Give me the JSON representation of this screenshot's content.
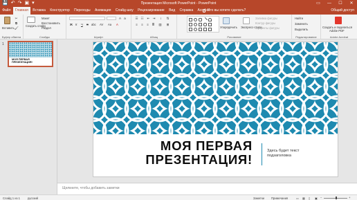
{
  "titlebar": {
    "title": "Презентация Microsoft PowerPoint  -  PowerPoint",
    "qat": [
      "💾",
      "↶",
      "↷",
      "▣",
      "▾"
    ],
    "controls": [
      "▭",
      "—",
      "☐",
      "✕"
    ]
  },
  "tabs": [
    "Файл",
    "Главная",
    "Вставка",
    "Конструктор",
    "Переходы",
    "Анимация",
    "Слайд-шоу",
    "Рецензирование",
    "Вид",
    "Справка",
    "Acrobat"
  ],
  "active_tab_index": 1,
  "tellme": "Что вы хотите сделать?",
  "share": "Общий доступ",
  "ribbon": {
    "clipboard": {
      "paste": "Вставить",
      "label": "Буфер обмена"
    },
    "slides": {
      "create": "Создать слайд",
      "layout": "Макет",
      "reset": "Восстановить",
      "section": "Раздел",
      "label": "Слайды"
    },
    "font": {
      "label": "Шрифт",
      "bold": "Ж",
      "italic": "К",
      "underline": "Ч",
      "strike": "S",
      "shadow": "abc",
      "spacing": "AV",
      "case": "Aa",
      "color": "A"
    },
    "paragraph": {
      "label": "Абзац"
    },
    "drawing": {
      "arrange": "Упорядочить",
      "quickstyles": "Экспресс-стили",
      "fill": "Заливка фигуры",
      "outline": "Контур фигуры",
      "effects": "Эффекты фигуры",
      "label": "Рисование"
    },
    "editing": {
      "find": "Найти",
      "replace": "Заменить",
      "select": "Выделить",
      "label": "Редактирование"
    },
    "acrobat": {
      "create": "Создать и поделиться",
      "pdf": "Adobe PDF",
      "label": "Adobe Acrobat"
    }
  },
  "thumbnail": {
    "number": "1",
    "title_line1": "МОЯ ПЕРВАЯ",
    "title_line2": "ПРЕЗЕНТАЦИЯ!"
  },
  "slide": {
    "title_line1": "МОЯ ПЕРВАЯ",
    "title_line2": "ПРЕЗЕНТАЦИЯ!",
    "subtitle_line1": "Здесь будет текст",
    "subtitle_line2": "подзаголовка"
  },
  "notes": "Щелкните, чтобы добавить заметки",
  "status": {
    "slide_counter": "Слайд 1 из 1",
    "language": "русский",
    "notes_btn": "Заметки",
    "comments_btn": "Примечания",
    "zoom_minus": "−",
    "zoom_plus": "+"
  },
  "colors": {
    "accent": "#b7472a",
    "pattern": "#1e8ab0"
  }
}
